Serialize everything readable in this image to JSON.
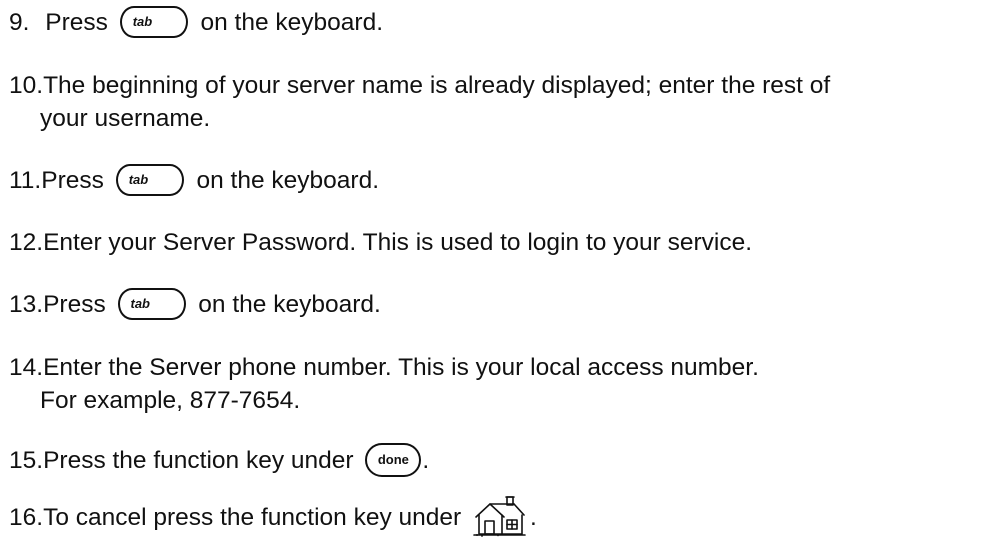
{
  "steps": [
    {
      "number": "9.",
      "before": "Press ",
      "key": "tab",
      "after": " on the keyboard."
    },
    {
      "number": "10.",
      "line1": "The beginning of your server name is already displayed; enter the rest of",
      "line2": "your username."
    },
    {
      "number": "11.",
      "before": "Press ",
      "key": "tab",
      "after": " on the keyboard."
    },
    {
      "number": "12.",
      "line1": "Enter your Server Password. This is used to login to your service."
    },
    {
      "number": "13.",
      "before": "Press ",
      "key": "tab",
      "after": " on the keyboard."
    },
    {
      "number": "14.",
      "line1": "Enter the Server phone number. This is your local access number.",
      "line2": "For example, 877-7654."
    },
    {
      "number": "15.",
      "before": "Press the function key under ",
      "key": "done",
      "after": "."
    },
    {
      "number": "16.",
      "before": "To cancel press the function key under ",
      "icon": "home-icon",
      "after": "."
    }
  ]
}
